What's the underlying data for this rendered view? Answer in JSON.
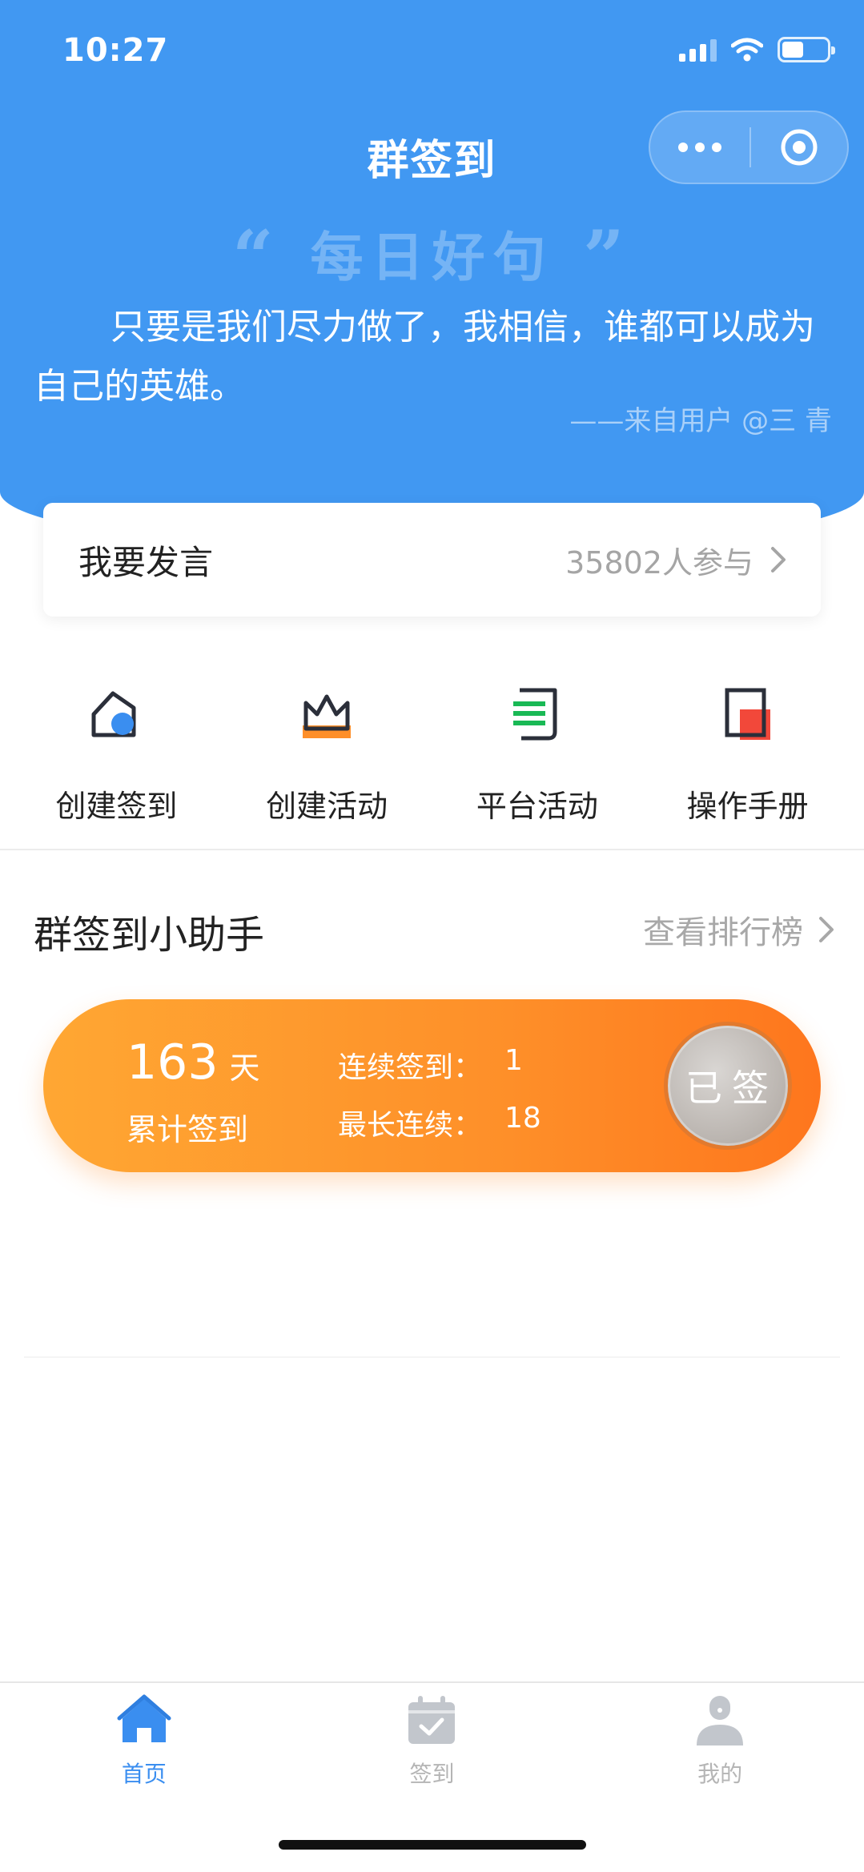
{
  "status_bar": {
    "time": "10:27",
    "battery_level": 0.48
  },
  "header": {
    "title": "群签到"
  },
  "quote": {
    "heading": "每日好句",
    "open_mark": "“",
    "close_mark": "”",
    "text": "只要是我们尽力做了，我相信，谁都可以成为自己的英雄。",
    "author": "——来自用户 @三 青"
  },
  "speak": {
    "label": "我要发言",
    "participants": "35802人参与"
  },
  "actions": [
    {
      "label": "创建签到",
      "icon": "tag-icon"
    },
    {
      "label": "创建活动",
      "icon": "crown-icon"
    },
    {
      "label": "平台活动",
      "icon": "document-icon"
    },
    {
      "label": "操作手册",
      "icon": "manual-icon"
    }
  ],
  "assistant": {
    "title": "群签到小助手",
    "ranking_link": "查看排行榜",
    "total_days": "163",
    "days_unit": "天",
    "total_label": "累计签到",
    "consecutive_label": "连续签到：",
    "consecutive_value": "1",
    "longest_label": "最长连续：",
    "longest_value": "18",
    "checked_label": "已签"
  },
  "tabbar": [
    {
      "label": "首页",
      "icon": "home-icon",
      "active": true
    },
    {
      "label": "签到",
      "icon": "calendar-check-icon",
      "active": false
    },
    {
      "label": "我的",
      "icon": "user-icon",
      "active": false
    }
  ],
  "colors": {
    "primary_blue": "#4198f2",
    "accent_orange": "#fe8f29",
    "tab_active": "#3a8ef0",
    "tab_inactive": "#b5b5b5"
  }
}
